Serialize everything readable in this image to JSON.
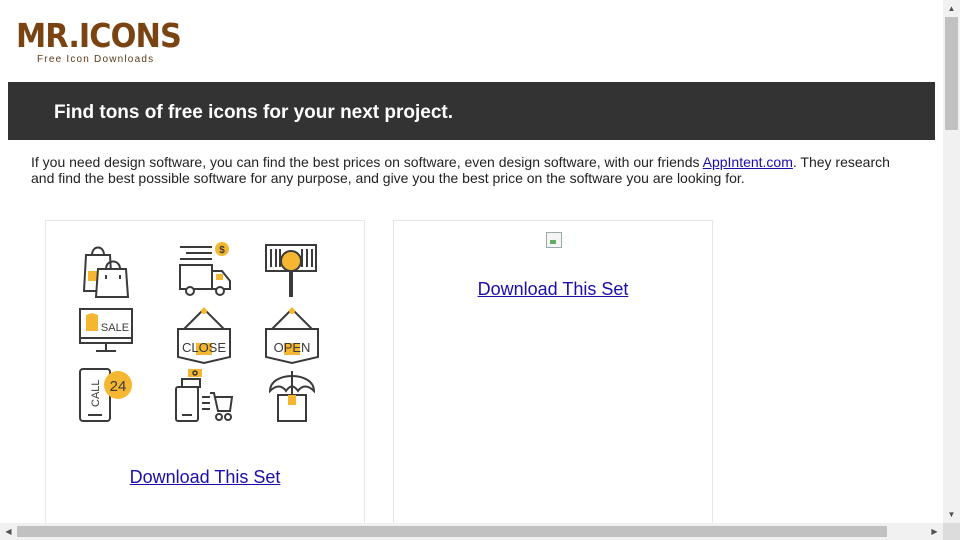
{
  "logo": {
    "title": "MR.ICONS",
    "tagline": "Free Icon Downloads"
  },
  "banner": {
    "title": "Find tons of free icons for your next project."
  },
  "intro": {
    "text_before": "If you need design software, you can find the best prices on software, even design software, with our friends ",
    "link_text": "AppIntent.com",
    "text_after": ". They research and find the best possible software for any purpose, and give you the best price on the software you are looking for."
  },
  "cards": [
    {
      "download_label": "Download This Set",
      "icons": [
        "shopping-bags-icon",
        "delivery-truck-icon",
        "barcode-search-icon",
        "monitor-sale-icon",
        "close-sign-icon",
        "open-sign-icon",
        "call-24-icon",
        "phone-cart-icon",
        "umbrella-box-icon"
      ],
      "icon_labels": {
        "sale": "SALE",
        "close": "CLOSE",
        "open": "OPEN",
        "call": "CALL",
        "hours": "24",
        "dollar": "$"
      }
    },
    {
      "download_label": "Download This Set"
    }
  ],
  "colors": {
    "banner_bg": "#333333",
    "logo_brown": "#7a4312",
    "icon_accent": "#f5b731",
    "icon_stroke": "#3a3a3a",
    "link": "#1a0dab"
  }
}
